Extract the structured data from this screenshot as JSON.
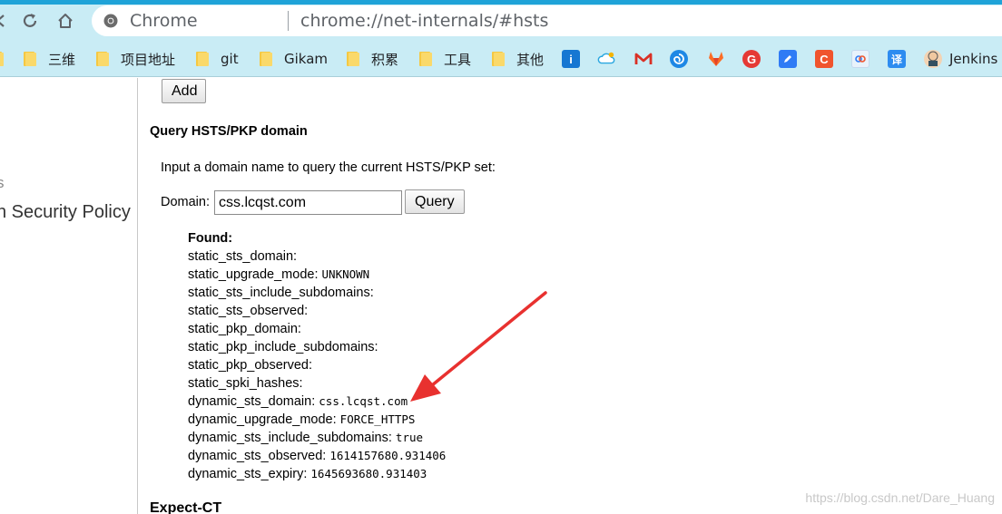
{
  "browser": {
    "omnibox_label": "Chrome",
    "url": "chrome://net-internals/#hsts"
  },
  "bookmarks": [
    {
      "label": "三维",
      "icon": "folder-icon"
    },
    {
      "label": "项目地址",
      "icon": "folder-icon"
    },
    {
      "label": "git",
      "icon": "folder-icon"
    },
    {
      "label": "Gikam",
      "icon": "folder-icon"
    },
    {
      "label": "积累",
      "icon": "folder-icon"
    },
    {
      "label": "工具",
      "icon": "folder-icon"
    },
    {
      "label": "其他",
      "icon": "folder-icon"
    },
    {
      "label": "Jenkins",
      "icon": "jenkins-icon"
    }
  ],
  "sidebar": {
    "dim_text": "s",
    "item": "n Security Policy"
  },
  "main": {
    "add_button": "Add",
    "query_heading": "Query HSTS/PKP domain",
    "instructions": "Input a domain name to query the current HSTS/PKP set:",
    "domain_label": "Domain:",
    "domain_value": "css.lcqst.com",
    "query_button": "Query",
    "found_label": "Found:",
    "results": [
      {
        "key": "static_sts_domain:",
        "value": ""
      },
      {
        "key": "static_upgrade_mode:",
        "value": "UNKNOWN"
      },
      {
        "key": "static_sts_include_subdomains:",
        "value": ""
      },
      {
        "key": "static_sts_observed:",
        "value": ""
      },
      {
        "key": "static_pkp_domain:",
        "value": ""
      },
      {
        "key": "static_pkp_include_subdomains:",
        "value": ""
      },
      {
        "key": "static_pkp_observed:",
        "value": ""
      },
      {
        "key": "static_spki_hashes:",
        "value": ""
      },
      {
        "key": "dynamic_sts_domain:",
        "value": "css.lcqst.com"
      },
      {
        "key": "dynamic_upgrade_mode:",
        "value": "FORCE_HTTPS"
      },
      {
        "key": "dynamic_sts_include_subdomains:",
        "value": "true"
      },
      {
        "key": "dynamic_sts_observed:",
        "value": "1614157680.931406"
      },
      {
        "key": "dynamic_sts_expiry:",
        "value": "1645693680.931403"
      }
    ],
    "next_heading": "Expect-CT"
  },
  "watermark": "https://blog.csdn.net/Dare_Huang",
  "colors": {
    "annotation_arrow": "#e8312f",
    "toolbar_bg": "#c9ecf5"
  }
}
